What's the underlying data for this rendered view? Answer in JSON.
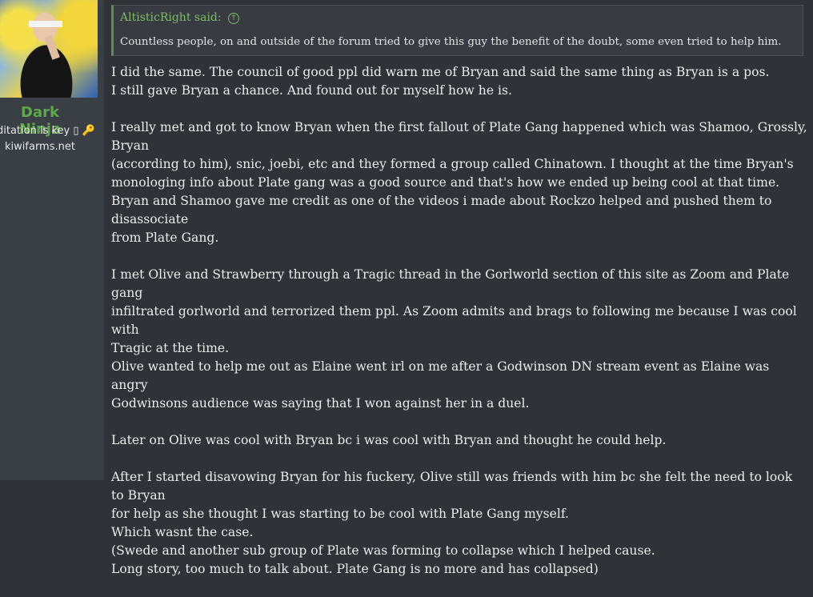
{
  "user": {
    "name": "Dark Ninja",
    "title": "editation is key ▯",
    "site": "kiwifarms.net"
  },
  "quote": {
    "author": "AltisticRight said:",
    "text": "Countless people, on and outside of the forum tried to give this guy the benefit of the doubt, some even tried to help him."
  },
  "post": {
    "paragraphs": [
      "I did the same. The council of good ppl did warn me of Bryan and said the same thing as Bryan is a pos.\nI still gave Bryan a chance. And found out for myself how he is.",
      "I really met and got to know Bryan when the first fallout of Plate Gang happened which was Shamoo, Grossly, Bryan\n(according to him), snic, joebi, etc and they formed a group called Chinatown. I thought at the time Bryan's\nmonologing info about Plate gang was a good source and that's how we ended up being cool at that time.\nBryan and Shamoo gave me credit as one of the videos i made about Rockzo helped and pushed them to disassociate\nfrom Plate Gang.",
      "I met Olive and Strawberry through a Tragic thread in the Gorlworld section of this site as Zoom and Plate gang\ninfiltrated gorlworld and terrorized them ppl. As Zoom admits and brags to following me because I was cool with\nTragic at the time.\nOlive wanted to help me out as Elaine went irl on me after a Godwinson DN stream event as Elaine was angry\nGodwinsons audience was saying that I won against her in a duel.",
      "Later on Olive was cool with Bryan bc i was cool with Bryan and thought he could help.",
      "After I started disavowing Bryan for his fuckery, Olive still was friends with him bc she felt the need to look to Bryan\nfor help as she thought I was starting to be cool with Plate Gang myself.\nWhich wasnt the case.\n(Swede and another sub group of Plate was forming to collapse which I helped cause.\nLong story, too much to talk about. Plate Gang is no more and has collapsed)"
    ]
  }
}
